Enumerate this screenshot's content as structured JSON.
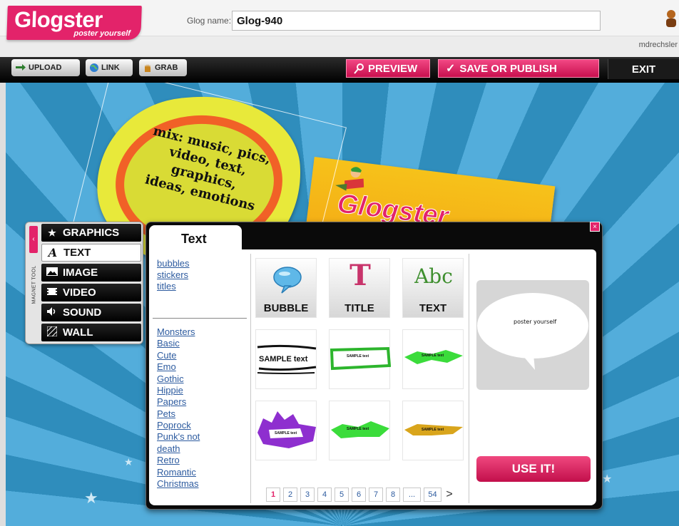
{
  "header": {
    "logo_main": "Glogster",
    "logo_tagline": "poster yourself",
    "glog_name_label": "Glog name:",
    "glog_name_value": "Glog-940",
    "username": "mdrechsler"
  },
  "toolbar": {
    "upload": "UPLOAD",
    "link": "LINK",
    "grab": "GRAB",
    "preview": "PREVIEW",
    "save": "SAVE OR PUBLISH",
    "exit": "EXIT"
  },
  "canvas": {
    "badge_text_lines": [
      "mix: music, pics,",
      "video, text, graphics,",
      "ideas, emotions"
    ],
    "poster_logo": "Glogster"
  },
  "magnet_tool": {
    "label": "MAGNET TOOL",
    "items": [
      {
        "label": "GRAPHICS",
        "icon": "star-icon"
      },
      {
        "label": "TEXT",
        "icon": "text-a-icon"
      },
      {
        "label": "IMAGE",
        "icon": "image-icon"
      },
      {
        "label": "VIDEO",
        "icon": "film-icon"
      },
      {
        "label": "SOUND",
        "icon": "speaker-icon"
      },
      {
        "label": "WALL",
        "icon": "wall-icon"
      }
    ],
    "active": "TEXT"
  },
  "panel": {
    "tab_title": "Text",
    "types": [
      "bubbles",
      "stickers",
      "titles"
    ],
    "styles": [
      "Monsters",
      "Basic",
      "Cute",
      "Emo",
      "Gothic",
      "Hippie",
      "Papers",
      "Pets",
      "Poprock",
      "Punk's not",
      "death",
      "Retro",
      "Romantic",
      "Christmas"
    ],
    "top_tiles": [
      "BUBBLE",
      "TITLE",
      "TEXT"
    ],
    "tile_sample_text": "SAMPLE text",
    "preview_text": "poster yourself",
    "use_button": "USE IT!",
    "pages": [
      "1",
      "2",
      "3",
      "4",
      "5",
      "6",
      "7",
      "8",
      "...",
      "54"
    ],
    "current_page": "1",
    "next_arrow": ">"
  },
  "colors": {
    "brand_pink": "#e3236a",
    "toolbar_black": "#000000",
    "canvas_blue": "#3a97c7",
    "link_blue": "#2d5b9f"
  }
}
